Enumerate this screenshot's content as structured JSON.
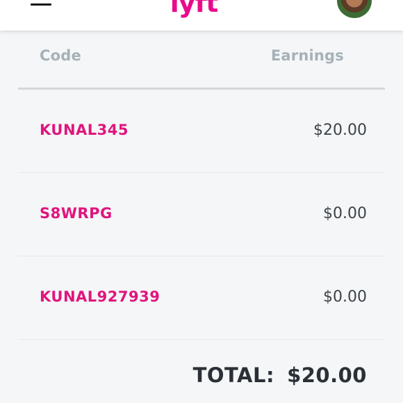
{
  "header": {
    "logo_text": "lyft",
    "brand_color": "#ea0b8c",
    "menu_icon": "hamburger-menu-icon",
    "avatar": "user-avatar"
  },
  "table": {
    "columns": [
      "Code",
      "Earnings"
    ],
    "rows": [
      {
        "code": "KUNAL345",
        "earnings": "$20.00"
      },
      {
        "code": "S8WRPG",
        "earnings": "$0.00"
      },
      {
        "code": "KUNAL927939",
        "earnings": "$0.00"
      }
    ]
  },
  "total": {
    "label": "TOTAL:",
    "value": "$20.00"
  },
  "colors": {
    "code_text": "#e0157e",
    "header_text": "#a6b1b8",
    "amount_text": "#3d4348",
    "total_text": "#2b3036",
    "background": "#f5f6f7"
  }
}
